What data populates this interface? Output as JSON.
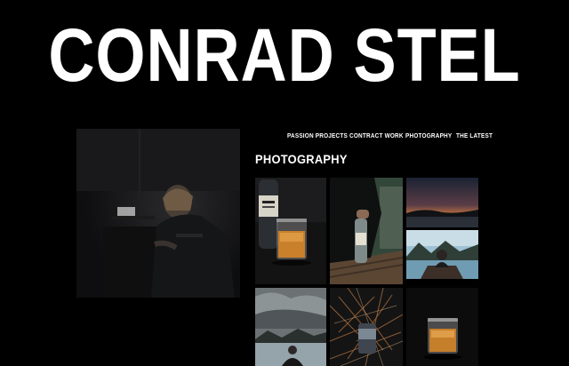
{
  "site": {
    "title": "CONRAD STEL"
  },
  "nav": {
    "items": [
      {
        "label": "PASSION PROJECTS"
      },
      {
        "label": "CONTRACT WORK"
      },
      {
        "label": "PHOTOGRAPHY"
      },
      {
        "label": "THE LATEST"
      }
    ]
  },
  "section": {
    "heading": "PHOTOGRAPHY"
  },
  "gallery": {
    "photos": [
      {
        "subject": "vodka bottle with whiskey glass"
      },
      {
        "subject": "person holding bottle on dock"
      },
      {
        "subject": "lake at sunset"
      },
      {
        "subject": "person in canoe on mountain lake"
      },
      {
        "subject": "person by lake under cloudy sky"
      },
      {
        "subject": "can in dry grass"
      },
      {
        "subject": "whiskey glass on dark background"
      }
    ]
  },
  "portrait": {
    "subject": "man with laptop in dark room"
  }
}
